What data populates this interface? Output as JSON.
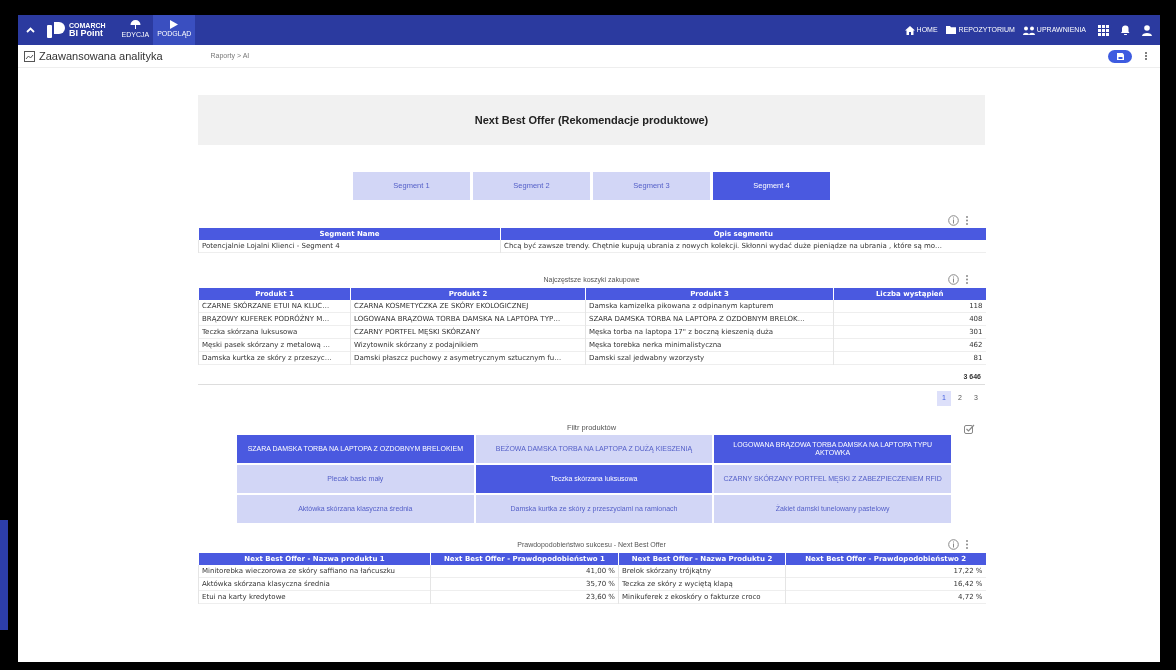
{
  "topbar": {
    "brand_top": "COMARCH",
    "brand_name": "BI Point",
    "modes": [
      {
        "label": "EDYCJA",
        "kind": "edit",
        "selected": false
      },
      {
        "label": "PODGLĄD",
        "kind": "view",
        "selected": true
      }
    ],
    "nav": [
      {
        "label": "HOME",
        "kind": "home"
      },
      {
        "label": "REPOZYTORIUM",
        "kind": "folder"
      },
      {
        "label": "UPRAWNIENIA",
        "kind": "users"
      }
    ]
  },
  "subheader": {
    "title": "Zaawansowana analityka",
    "breadcrumb": "Raporty > AI"
  },
  "report_title": "Next Best Offer (Rekomendacje produktowe)",
  "segments": [
    {
      "label": "Segment 1",
      "selected": false
    },
    {
      "label": "Segment 2",
      "selected": false
    },
    {
      "label": "Segment 3",
      "selected": false
    },
    {
      "label": "Segment 4",
      "selected": true
    }
  ],
  "segment_table": {
    "columns": [
      "Segment Name",
      "Opis segmentu"
    ],
    "rows": [
      [
        "Potencjalnie Lojalni Klienci - Segment 4",
        "Chcą być zawsze trendy. Chętnie kupują ubrania z nowych kolekcji. Skłonni wydać duże pieniądze na ubrania , które są mo…"
      ]
    ]
  },
  "baskets": {
    "title": "Najczęstsze koszyki zakupowe",
    "columns": [
      "Produkt 1",
      "Produkt 2",
      "Produkt 3",
      "Liczba wystąpień"
    ],
    "rows": [
      [
        "CZARNE SKÓRZANE ETUI NA KLUC…",
        "CZARNA KOSMETYCZKA ZE SKÓRY EKOLOGICZNEJ",
        "Damska kamizelka pikowana z odpinanym kapturem",
        "118"
      ],
      [
        "BRĄZOWY KUFEREK PODRÓŻNY M…",
        "LOGOWANA BRĄZOWA TORBA DAMSKA NA LAPTOPA TYP…",
        "SZARA DAMSKA TORBA NA LAPTOPA Z OZDOBNYM BRELOK…",
        "408"
      ],
      [
        "Teczka skórzana luksusowa",
        "CZARNY PORTFEL MĘSKI SKÓRZANY",
        "Męska torba na laptopa 17\" z boczną kieszenią duża",
        "301"
      ],
      [
        "Męski pasek skórzany z metalową …",
        "Wizytownik skórzany z podajnikiem",
        "Męska torebka nerka minimalistyczna",
        "462"
      ],
      [
        "Damska kurtka ze skóry z przeszyc…",
        "Damski płaszcz puchowy z asymetrycznym sztucznym fu…",
        "Damski szal jedwabny wzorzysty",
        "81"
      ]
    ],
    "total": "3 646",
    "pages": [
      {
        "label": "1",
        "selected": true
      },
      {
        "label": "2",
        "selected": false
      },
      {
        "label": "3",
        "selected": false
      }
    ]
  },
  "filter": {
    "title": "Filtr produktów",
    "items": [
      {
        "label": "SZARA DAMSKA TORBA NA LAPTOPA Z OZDOBNYM BRELOKIEM",
        "selected": true
      },
      {
        "label": "BEŻOWA DAMSKA TORBA NA LAPTOPA Z DUŻĄ KIESZENIĄ",
        "selected": false
      },
      {
        "label": "LOGOWANA BRĄZOWA TORBA DAMSKA NA LAPTOPA TYPU AKTOWKA",
        "selected": true
      },
      {
        "label": "Plecak basic mały",
        "selected": false
      },
      {
        "label": "Teczka skórzana luksusowa",
        "selected": true
      },
      {
        "label": "CZARNY SKÓRZANY PORTFEL MĘSKI Z ZABEZPIECZENIEM RFID",
        "selected": false
      },
      {
        "label": "Aktówka skórzana klasyczna średnia",
        "selected": false
      },
      {
        "label": "Damska kurtka ze skóry z przeszyciami na ramionach",
        "selected": false
      },
      {
        "label": "Żakiet damski tunelowany pastelowy",
        "selected": false
      }
    ]
  },
  "offers": {
    "title": "Prawdopodobieństwo sukcesu - Next Best Offer",
    "columns": [
      "Next Best Offer - Nazwa produktu 1",
      "Next Best Offer - Prawdopodobieństwo 1",
      "Next Best Offer - Nazwa Produktu 2",
      "Next Best Offer - Prawdopodobieństwo 2"
    ],
    "rows": [
      [
        "Minitorebka wieczorowa ze skóry saffiano na łańcuszku",
        "41,00 %",
        "Brelok skórzany trójkątny",
        "17,22 %"
      ],
      [
        "Aktówka skórzana klasyczna średnia",
        "35,70 %",
        "Teczka ze skóry z wyciętą klapą",
        "16,42 %"
      ],
      [
        "Etui na karty kredytowe",
        "23,60 %",
        "Minikuferek z ekoskóry o fakturze croco",
        "4,72 %"
      ]
    ]
  }
}
